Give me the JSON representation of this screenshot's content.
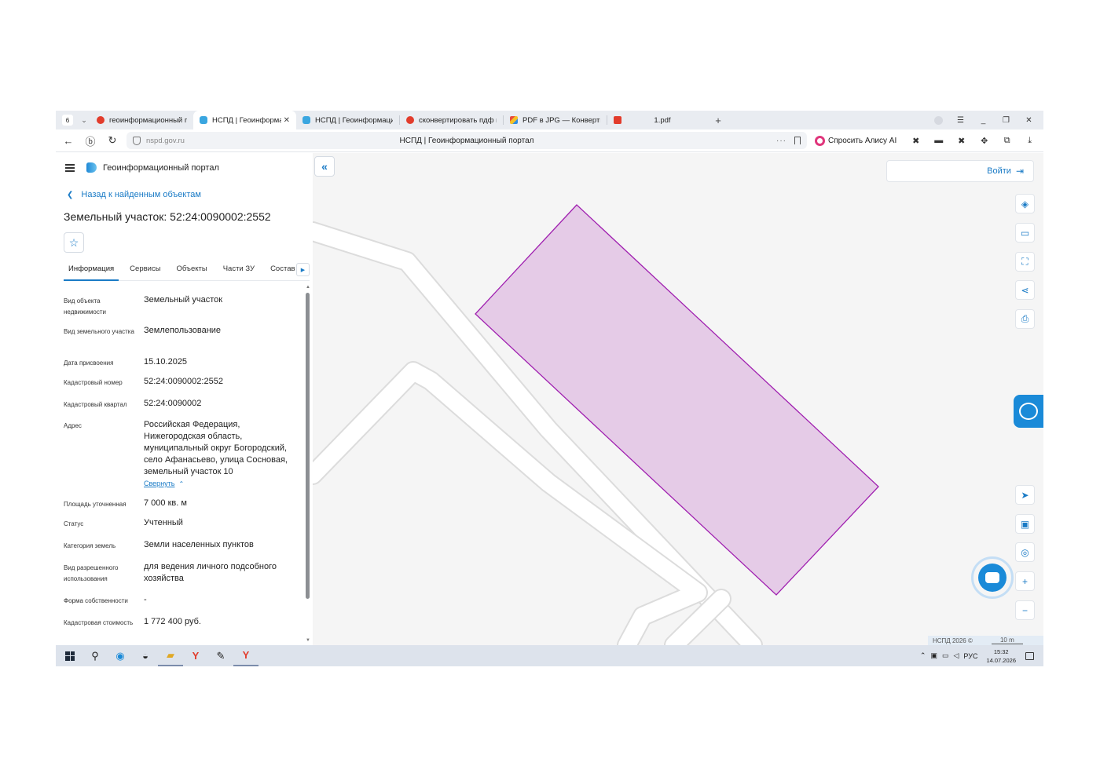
{
  "browser": {
    "tab_count": "6",
    "tabs": [
      {
        "title": "геоинформационный пор",
        "favicon": "yandex-icon",
        "active": false
      },
      {
        "title": "НСПД | Геоинформаци",
        "favicon": "nspd-icon",
        "active": true
      },
      {
        "title": "НСПД | Геоинформацион",
        "favicon": "nspd-icon",
        "active": false
      },
      {
        "title": "сконвертировать пдф в jp",
        "favicon": "yandex-icon",
        "active": false
      },
      {
        "title": "PDF в JPG — Конвертиру",
        "favicon": "pdfjpg-icon",
        "active": false
      },
      {
        "title": "1.pdf",
        "favicon": "pdf-icon",
        "active": false
      }
    ],
    "url": "nspd.gov.ru",
    "page_title": "НСПД | Геоинформационный портал",
    "alice_label": "Спросить Алису AI"
  },
  "panel": {
    "portal_title": "Геоинформационный портал",
    "back_label": "Назад к найденным объектам",
    "object_title": "Земельный участок: 52:24:0090002:2552",
    "tabs": [
      "Информация",
      "Сервисы",
      "Объекты",
      "Части ЗУ",
      "Состав"
    ],
    "properties": [
      {
        "key": "Вид объекта недвижимости",
        "value": "Земельный участок"
      },
      {
        "key": "Вид земельного участка",
        "value": "Землепользование"
      },
      {
        "key": "Дата присвоения",
        "value": "15.10.2025"
      },
      {
        "key": "Кадастровый номер",
        "value": "52:24:0090002:2552"
      },
      {
        "key": "Кадастровый квартал",
        "value": "52:24:0090002"
      },
      {
        "key": "Адрес",
        "value": "Российская Федерация, Нижегородская область, муниципальный округ Богородский, село Афанасьево, улица Сосновая, земельный участок 10"
      },
      {
        "key": "Площадь уточненная",
        "value": "7 000 кв. м"
      },
      {
        "key": "Статус",
        "value": "Учтенный"
      },
      {
        "key": "Категория земель",
        "value": "Земли населенных пунктов"
      },
      {
        "key": "Вид разрешенного использования",
        "value": "для ведения личного подсобного хозяйства"
      },
      {
        "key": "Форма собственности",
        "value": "-"
      },
      {
        "key": "Кадастровая стоимость",
        "value": "1 772 400 руб."
      }
    ],
    "collapse_label": "Свернуть"
  },
  "map": {
    "login_label": "Войти",
    "attribution": "НСПД 2026 ©",
    "scale_label": "10 m",
    "parcel_fill": "#e5cbe7",
    "parcel_stroke": "#a020b0"
  },
  "taskbar": {
    "language": "РУС",
    "time": "15:32",
    "date": "14.07.2026"
  },
  "colors": {
    "accent": "#1a7bc6",
    "map_background": "#f5f5f5",
    "road_fill": "#ffffff",
    "road_edge": "#dcdcdc"
  }
}
